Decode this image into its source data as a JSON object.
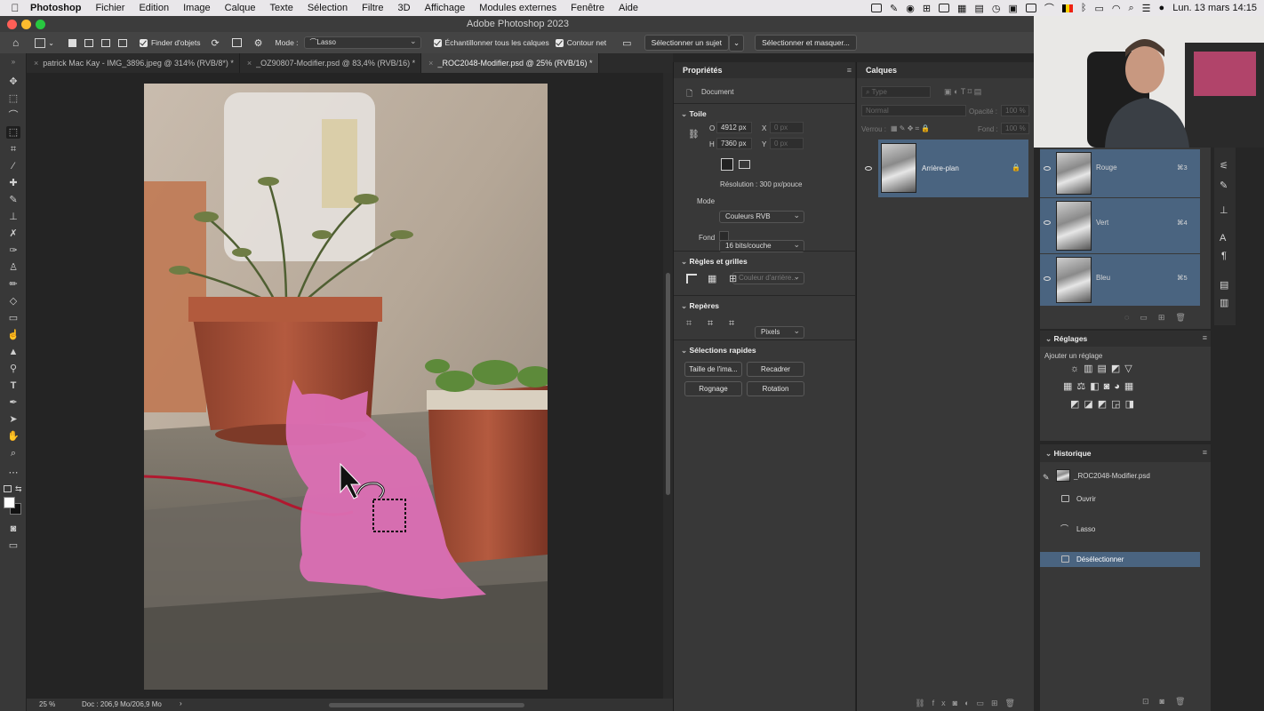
{
  "menubar": {
    "app": "Photoshop",
    "items": [
      "Fichier",
      "Edition",
      "Image",
      "Calque",
      "Texte",
      "Sélection",
      "Filtre",
      "3D",
      "Affichage",
      "Modules externes",
      "Fenêtre",
      "Aide"
    ],
    "clock": "Lun. 13 mars  14:15"
  },
  "window": {
    "title": "Adobe Photoshop 2023"
  },
  "options": {
    "finder": "Finder d'objets",
    "mode_label": "Mode :",
    "mode_value": "Lasso",
    "sample_all": "Échantillonner tous les calques",
    "hard_edge": "Contour net",
    "select_subject": "Sélectionner un sujet",
    "select_mask": "Sélectionner et masquer..."
  },
  "tabs": [
    {
      "label": "patrick Mac Kay - IMG_3896.jpeg @ 314% (RVB/8*) *"
    },
    {
      "label": "_OZ90807-Modifier.psd @ 83,4% (RVB/16) *"
    },
    {
      "label": "_ROC2048-Modifier.psd @ 25% (RVB/16) *"
    }
  ],
  "status": {
    "zoom": "25 %",
    "doc": "Doc : 206,9 Mo/206,9 Mo",
    "arrow": "›"
  },
  "properties": {
    "title": "Propriétés",
    "doc_label": "Document",
    "canvas_section": "Toile",
    "w_label": "O",
    "w_value": "4912 px",
    "h_label": "H",
    "h_value": "7360 px",
    "x_label": "X",
    "x_placeholder": "0 px",
    "y_label": "Y",
    "y_placeholder": "0 px",
    "resolution": "Résolution : 300 px/pouce",
    "mode_label": "Mode",
    "mode_value": "Couleurs RVB",
    "depth_value": "16 bits/couche",
    "bg_label": "Fond",
    "bg_value": "Couleur d'arrière...",
    "rulers_section": "Règles et grilles",
    "units_value": "Pixels",
    "guides_section": "Repères",
    "quick_section": "Sélections rapides",
    "btn_size": "Taille de l'ima...",
    "btn_crop": "Recadrer",
    "btn_trim": "Rognage",
    "btn_rotate": "Rotation"
  },
  "layers": {
    "title": "Calques",
    "filter_placeholder": "Type",
    "blend": "Normal",
    "opacity_label": "Opacité :",
    "opacity_value": "100 %",
    "lock_label": "Verrou :",
    "fill_label": "Fond :",
    "fill_value": "100 %",
    "items": [
      {
        "name": "Arrière-plan"
      }
    ]
  },
  "channels": {
    "items": [
      {
        "name": "Rouge",
        "shortcut": "⌘3"
      },
      {
        "name": "Vert",
        "shortcut": "⌘4"
      },
      {
        "name": "Bleu",
        "shortcut": "⌘5"
      }
    ]
  },
  "adjustments": {
    "title": "Réglages",
    "subtitle": "Ajouter un réglage"
  },
  "history": {
    "title": "Historique",
    "snapshot": "_ROC2048-Modifier.psd",
    "items": [
      {
        "name": "Ouvrir"
      },
      {
        "name": "Lasso"
      },
      {
        "name": "Désélectionner"
      }
    ]
  },
  "colors": {
    "accent": "#4a6480",
    "mask": "#e070b8",
    "panel": "#383838"
  }
}
